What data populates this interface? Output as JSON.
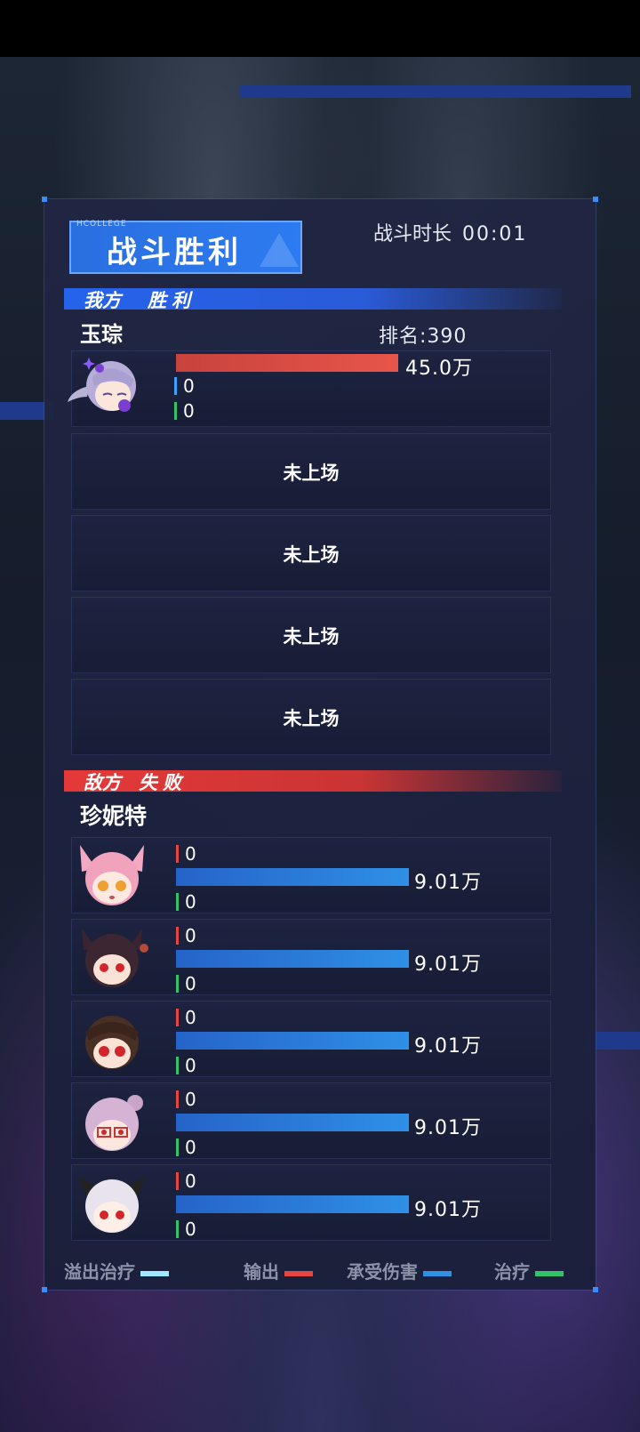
{
  "header": {
    "title_tag": "HCOLLEGE",
    "title": "战斗胜利",
    "duration_label": "战斗时长",
    "duration_value": "00:01"
  },
  "ally": {
    "team_label": "我方",
    "result": "胜利",
    "player_name": "玉琮",
    "rank_label": "排名:390",
    "fighters": [
      {
        "avatar": "lavender-twintail-girl-avatar",
        "output": "45.0万",
        "output_fraction": 1.0,
        "damage_taken": "0",
        "healing": "0"
      }
    ],
    "empty_slots": [
      "未上场",
      "未上场",
      "未上场",
      "未上场"
    ]
  },
  "enemy": {
    "team_label": "敌方",
    "result": "失败",
    "player_name": "珍妮特",
    "fighters": [
      {
        "avatar": "pink-cat-ear-girl-avatar",
        "output": "0",
        "damage_taken": "9.01万",
        "damage_fraction": 1.0,
        "healing": "0"
      },
      {
        "avatar": "dark-hair-horned-girl-avatar",
        "output": "0",
        "damage_taken": "9.01万",
        "damage_fraction": 1.0,
        "healing": "0"
      },
      {
        "avatar": "brown-hair-girl-avatar",
        "output": "0",
        "damage_taken": "9.01万",
        "damage_fraction": 1.0,
        "healing": "0"
      },
      {
        "avatar": "lilac-hair-glasses-girl-avatar",
        "output": "0",
        "damage_taken": "9.01万",
        "damage_fraction": 1.0,
        "healing": "0"
      },
      {
        "avatar": "white-hair-black-horn-girl-avatar",
        "output": "0",
        "damage_taken": "9.01万",
        "damage_fraction": 1.0,
        "healing": "0"
      }
    ]
  },
  "legend": {
    "overflow_heal": "溢出治疗",
    "output": "输出",
    "damage_taken": "承受伤害",
    "healing": "治疗"
  },
  "colors": {
    "output": "#e5463f",
    "damage_taken": "#2f90e6",
    "healing": "#36c26a",
    "overflow_heal": "#9fe6ff",
    "ally": "#2563eb",
    "enemy": "#e53939"
  }
}
